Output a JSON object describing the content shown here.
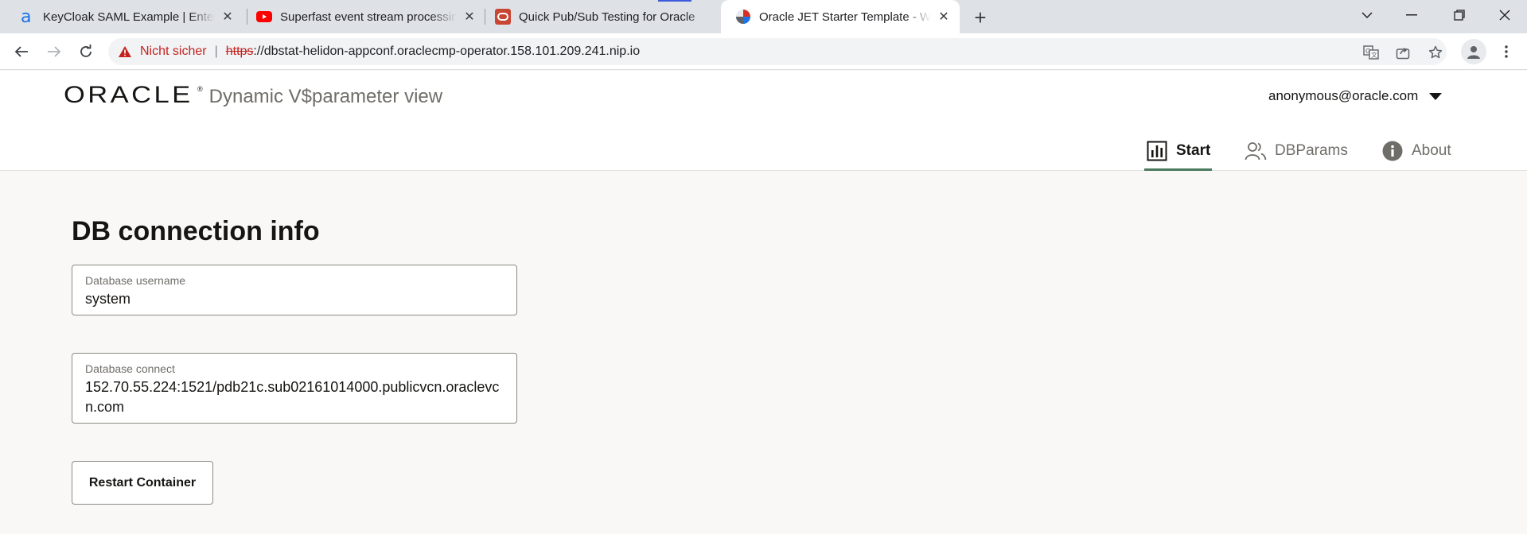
{
  "browser": {
    "tabs": [
      {
        "title": "KeyCloak SAML Example | Enterprise",
        "icon": "keycloak-icon",
        "active": false
      },
      {
        "title": "Superfast event stream processing",
        "icon": "youtube-icon",
        "active": false
      },
      {
        "title": "Quick Pub/Sub Testing for Oracle",
        "icon": "oracle-red-icon",
        "active": false
      },
      {
        "title": "Oracle JET Starter Template - Web",
        "icon": "oracle-jet-icon",
        "active": true
      }
    ],
    "security_label": "Nicht sicher",
    "url_scheme": "https",
    "url_rest": "://dbstat-helidon-appconf.oraclecmp-operator.158.101.209.241.nip.io",
    "colors": {
      "tabstrip": "#dee1e6",
      "insecure": "#c5221f"
    }
  },
  "app": {
    "logo_text": "ORACLE",
    "logo_reg": "®",
    "app_name": "Dynamic V$parameter view",
    "user_email": "anonymous@oracle.com",
    "nav": [
      {
        "label": "Start",
        "icon": "bar-chart-icon",
        "active": true
      },
      {
        "label": "DBParams",
        "icon": "users-icon",
        "active": false
      },
      {
        "label": "About",
        "icon": "info-icon",
        "active": false
      }
    ],
    "colors": {
      "nav_active_underline": "#4b7a5e",
      "page_background": "#f9f8f6"
    }
  },
  "main": {
    "title": "DB connection info",
    "username_label": "Database username",
    "username_value": "system",
    "connect_label": "Database connect",
    "connect_value": "152.70.55.224:1521/pdb21c.sub02161014000.publicvcn.oraclevcn.com",
    "restart_button": "Restart Container"
  }
}
